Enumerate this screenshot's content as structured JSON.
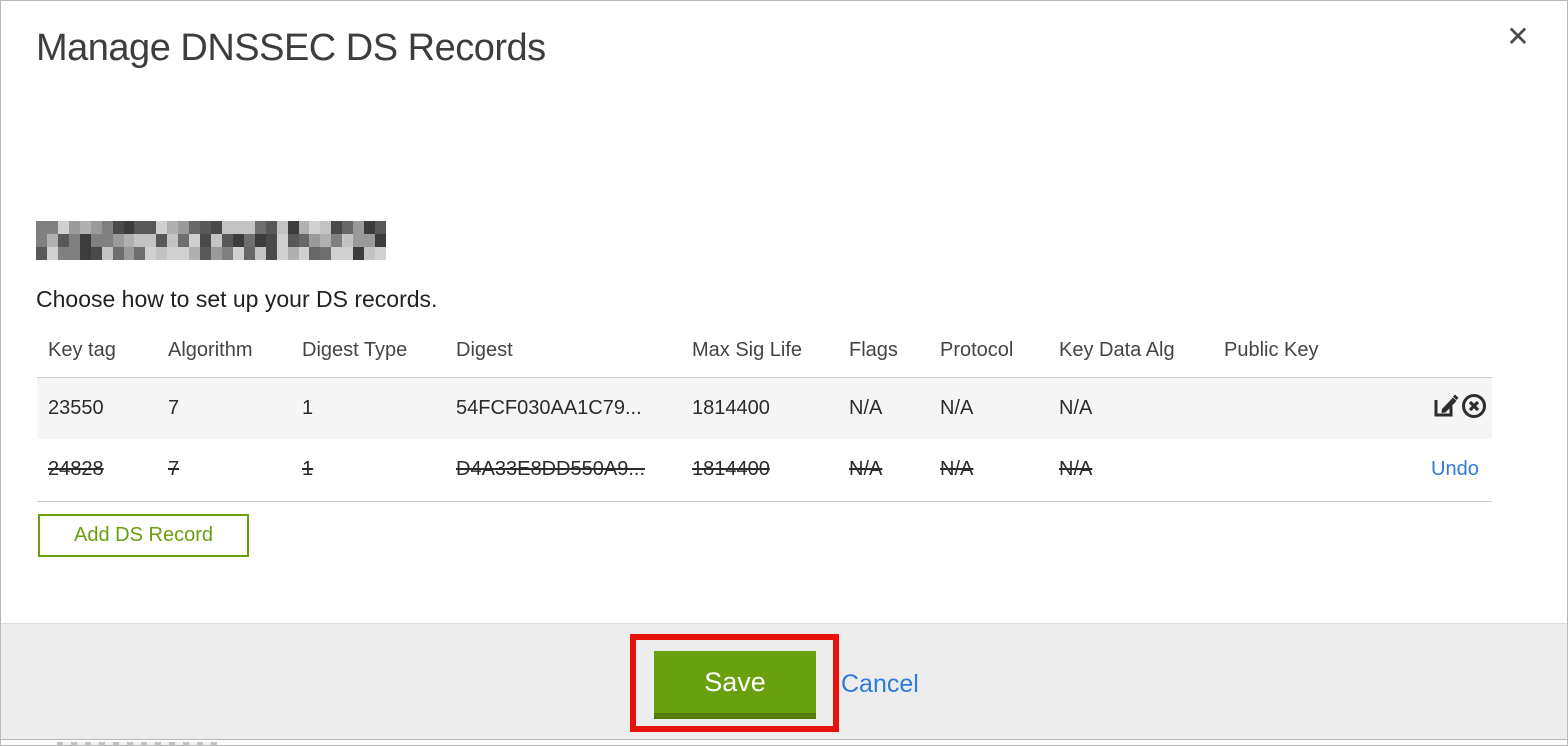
{
  "modal": {
    "title": "Manage DNSSEC DS Records",
    "close_icon": "✕",
    "instruction": "Choose how to set up your DS records.",
    "domain_redacted": true
  },
  "table": {
    "headers": [
      "Key tag",
      "Algorithm",
      "Digest Type",
      "Digest",
      "Max Sig Life",
      "Flags",
      "Protocol",
      "Key Data Alg",
      "Public Key"
    ],
    "rows": [
      {
        "key_tag": "23550",
        "algorithm": "7",
        "digest_type": "1",
        "digest": "54FCF030AA1C79...",
        "max_sig_life": "1814400",
        "flags": "N/A",
        "protocol": "N/A",
        "key_data_alg": "N/A",
        "public_key": "",
        "state": "normal",
        "actions": [
          "edit-icon",
          "delete-icon"
        ]
      },
      {
        "key_tag": "24828",
        "algorithm": "7",
        "digest_type": "1",
        "digest": "D4A33E8DD550A9...",
        "max_sig_life": "1814400",
        "flags": "N/A",
        "protocol": "N/A",
        "key_data_alg": "N/A",
        "public_key": "",
        "state": "deleted",
        "undo_label": "Undo"
      }
    ]
  },
  "buttons": {
    "add_ds_record": "Add DS Record",
    "save": "Save",
    "cancel": "Cancel"
  },
  "colors": {
    "green_button": "#69a10e",
    "green_button_shadow": "#527c04",
    "green_outline": "#6a9f0b",
    "link_blue": "#2e7bdb",
    "annotation_red": "#e8120c",
    "footer_bg": "#ededed",
    "row_alt_bg": "#f5f5f5",
    "border_gray": "#cccccc"
  }
}
